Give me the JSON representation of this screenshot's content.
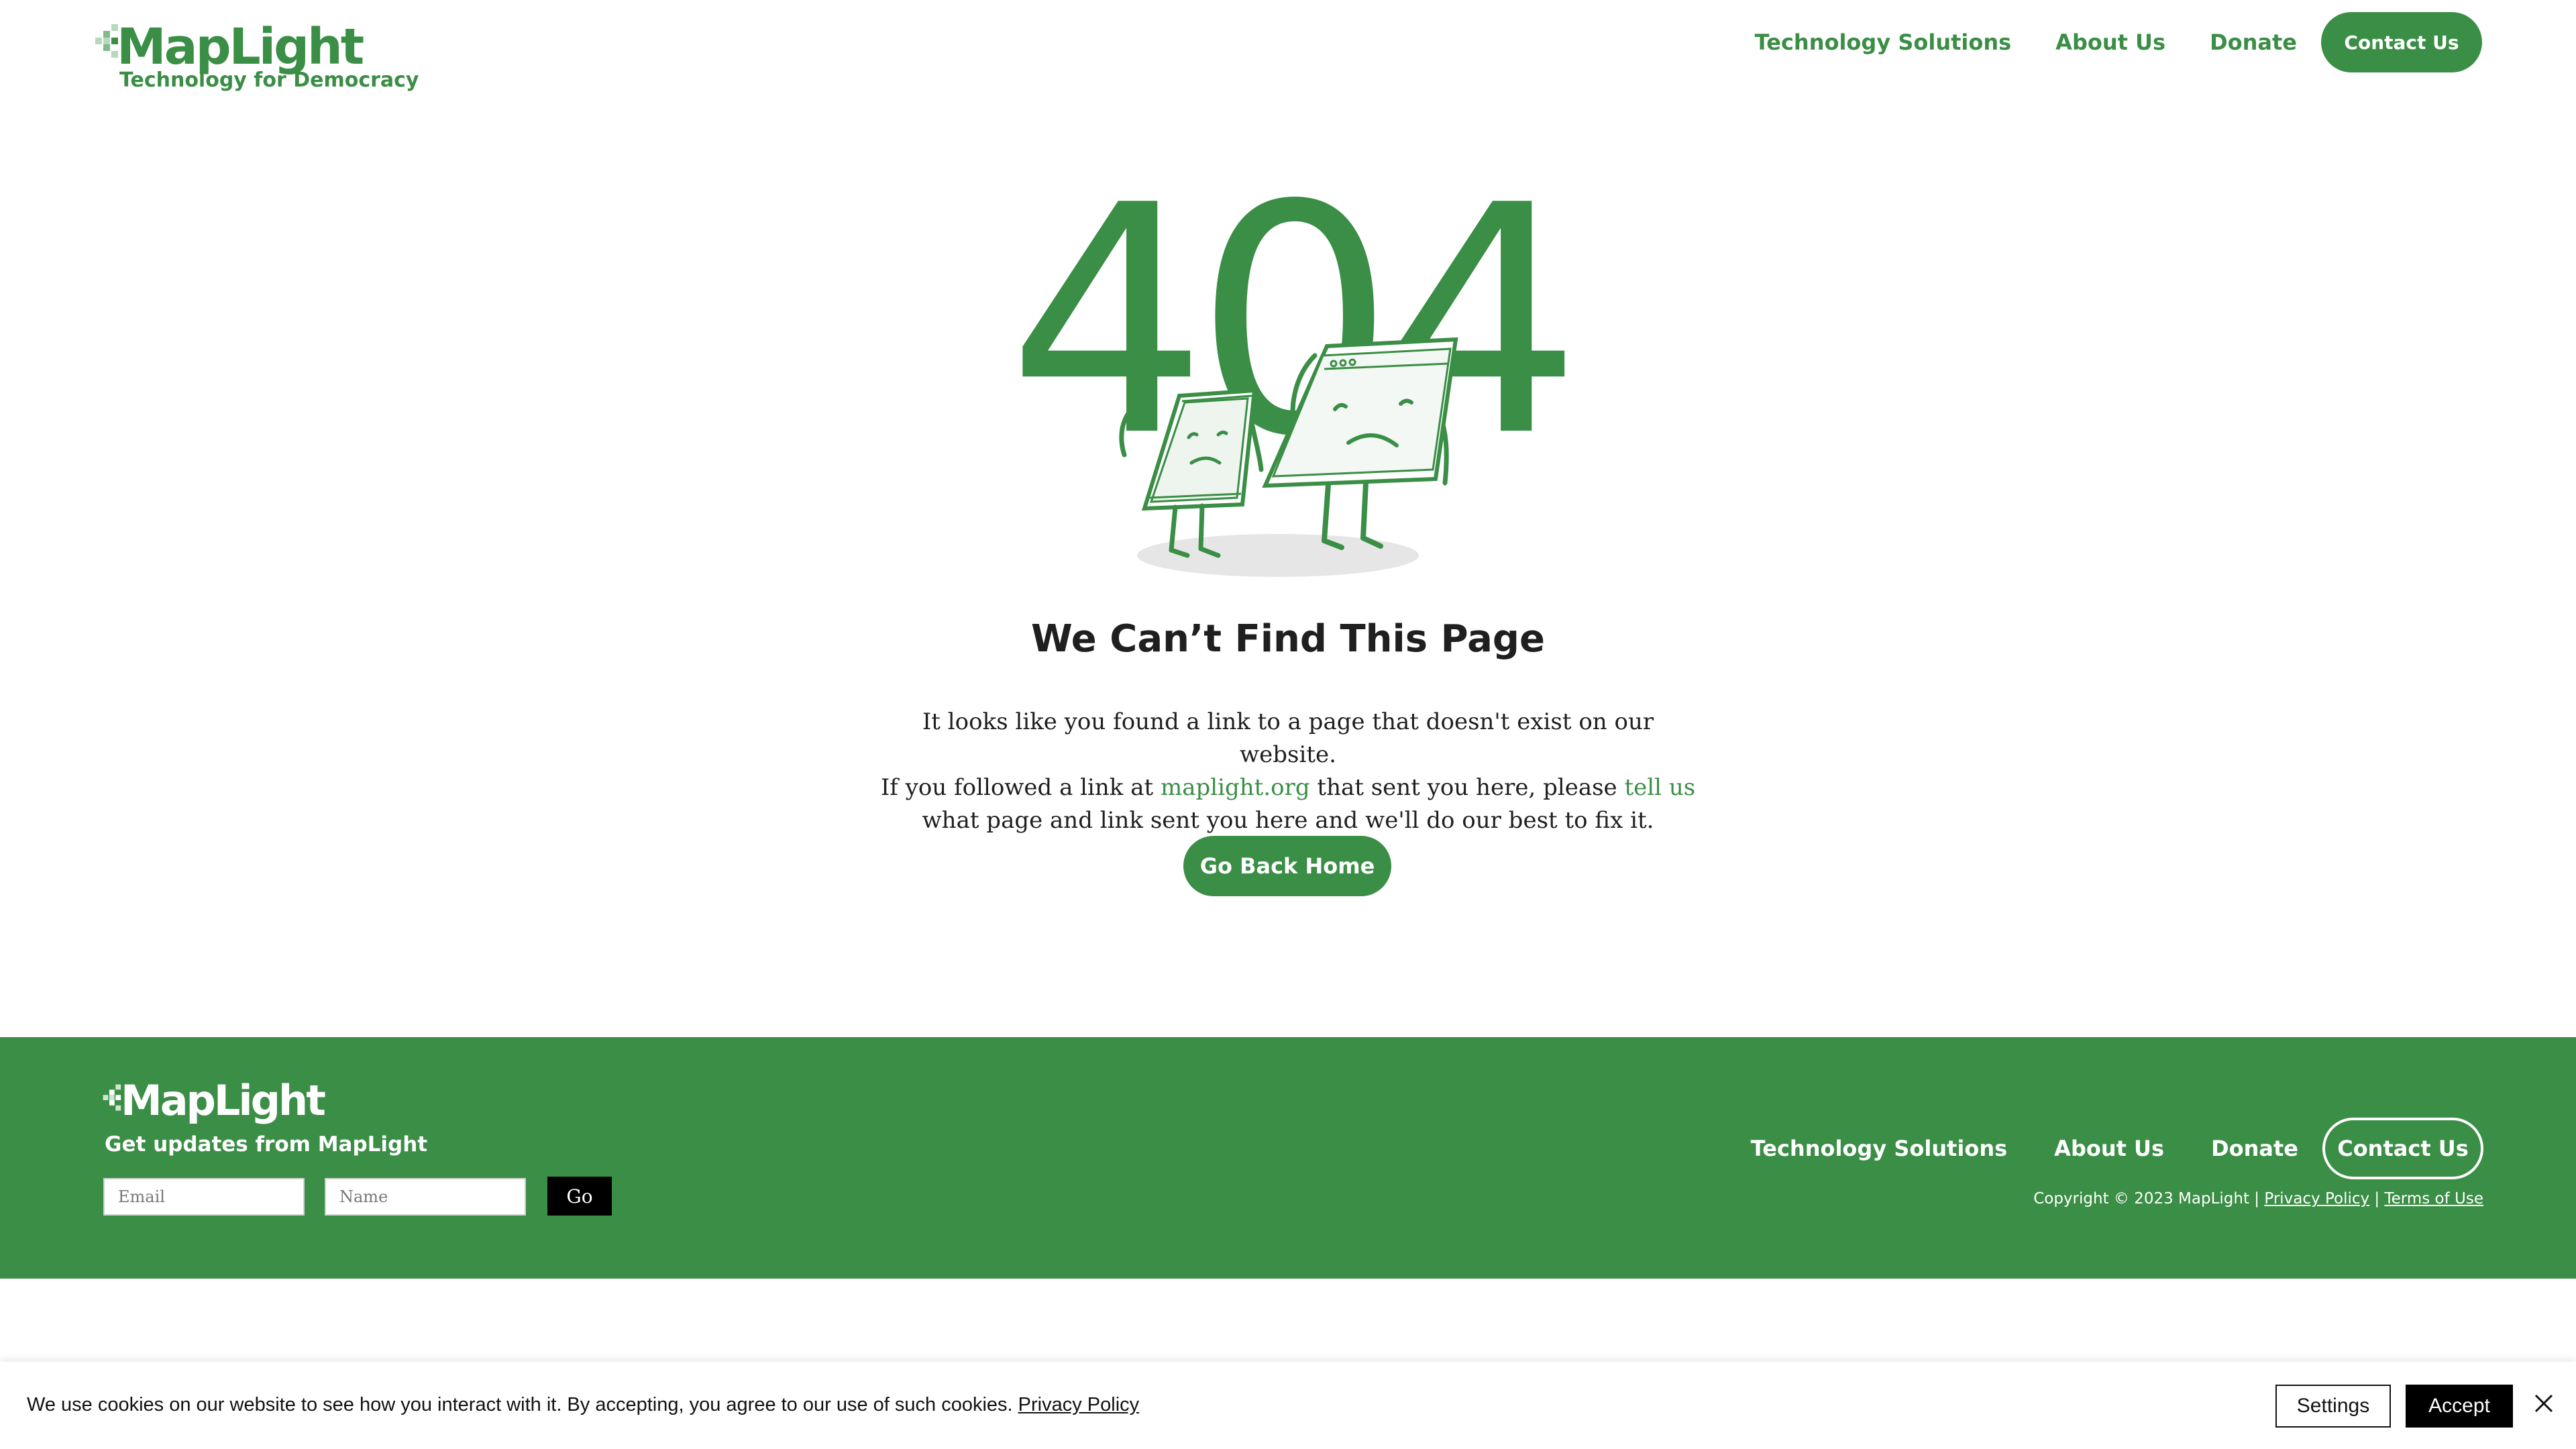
{
  "header": {
    "logo_text": "MapLight",
    "tagline": "Technology for Democracy",
    "nav": [
      "Technology Solutions",
      "About Us",
      "Donate"
    ],
    "contact_label": "Contact Us"
  },
  "main": {
    "error_code": "404",
    "title": "We Can’t Find This Page",
    "line1": "It looks like you found a link to a page that doesn't exist on our website.",
    "line2_pre": "If you followed a link at ",
    "line2_link": "maplight.org",
    "line2_mid": " that sent you here, please ",
    "line2_link2": "tell us",
    "line2_post": " what page and link sent you here and we'll do our best to fix it.",
    "home_button": "Go Back Home"
  },
  "footer": {
    "logo_text": "MapLight",
    "signup_title": "Get updates from MapLight",
    "email_placeholder": "Email",
    "name_placeholder": "Name",
    "go_label": "Go",
    "nav": [
      "Technology Solutions",
      "About Us",
      "Donate"
    ],
    "contact_label": "Contact Us",
    "copyright": "Copyright © 2023 MapLight | ",
    "privacy": "Privacy Policy",
    "sep": " | ",
    "terms": "Terms of Use"
  },
  "cookie": {
    "text": "We use cookies on our website to see how you interact with it. By accepting, you agree to our use of such cookies. ",
    "privacy": "Privacy Policy",
    "settings_label": "Settings",
    "accept_label": "Accept"
  },
  "icons": {
    "logo_mark": "pixel-arrow-icon",
    "close": "close-icon",
    "illustration": "sad-devices-illustration"
  },
  "colors": {
    "brand_green": "#3a8e45",
    "text_dark": "#1f1f1f",
    "footer_bg": "#3a8e45"
  }
}
